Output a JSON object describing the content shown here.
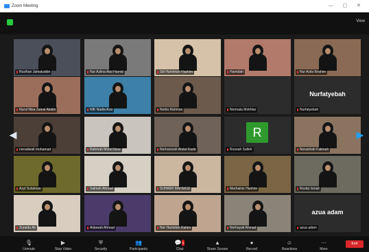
{
  "window": {
    "title": "Zoom Meeting"
  },
  "topbar": {
    "view_label": "View"
  },
  "participants": [
    {
      "name": "Rozihan Jamaluddin",
      "active": true,
      "bg": "#4a4f5a"
    },
    {
      "name": "Nur Azlina Abd Hamid",
      "bg": "#7a7a7a"
    },
    {
      "name": "Siti Hamimah Hashim",
      "bg": "#d6c2a8"
    },
    {
      "name": "Hamidah",
      "bg": "#b27a6a"
    },
    {
      "name": "Nur Azila Ibrahim",
      "bg": "#8a6a54"
    },
    {
      "name": "Nurul Nisa Zainal Abidin",
      "bg": "#9b6e5c"
    },
    {
      "name": "NIK Nadia Aziz",
      "bg": "#3d80a8"
    },
    {
      "name": "Norlia Rahman",
      "bg": "#6c5a4c"
    },
    {
      "name": "Normala Mokhtar",
      "bg": "#2c2c2c",
      "video": false
    },
    {
      "name": "Nurfatyebah",
      "bg": "#2c2c2c",
      "video": false,
      "display": "Nurfatyebah"
    },
    {
      "name": "norsalwati mohamad",
      "bg": "#4b3f38"
    },
    {
      "name": "Rahmah Mohd Noor",
      "bg": "#c9c4bd"
    },
    {
      "name": "Norhanizah Abdul Kadir",
      "bg": "#6f6258"
    },
    {
      "name": "Rosnah Salleh",
      "bg": "#2c2c2c",
      "video": false,
      "avatar": "R"
    },
    {
      "name": "Noraishah Fatimah",
      "bg": "#8a7460"
    },
    {
      "name": "Azyl Sulaiman",
      "bg": "#6e6a2c"
    },
    {
      "name": "Salmah Ahmad",
      "bg": "#d6cfc3"
    },
    {
      "name": "SUHAIRI MAHMOD",
      "bg": "#cbb6a0"
    },
    {
      "name": "Marhainis Hashim",
      "bg": "#7a6544"
    },
    {
      "name": "Rozita Ismail",
      "bg": "#6d6a5f"
    },
    {
      "name": "Zuraida Ali",
      "bg": "#d8cdbf"
    },
    {
      "name": "Aidawati Ahmad",
      "bg": "#4b3b6a"
    },
    {
      "name": "Nor Hamidah Rahim",
      "bg": "#bfa590"
    },
    {
      "name": "Norhayati Ahmad",
      "bg": "#8a8478"
    },
    {
      "name": "azua adam",
      "bg": "#2c2c2c",
      "video": false,
      "display": "azua adam"
    }
  ],
  "toolbar": {
    "items": [
      {
        "label": "Unmute",
        "icon": "microphone-icon",
        "glyph": "🎙"
      },
      {
        "label": "Stop Video",
        "icon": "video-camera-icon",
        "glyph": "▶"
      },
      {
        "label": "Security",
        "icon": "shield-icon",
        "glyph": "⛨"
      },
      {
        "label": "Participants",
        "icon": "participants-icon",
        "glyph": "👥"
      },
      {
        "label": "Chat",
        "icon": "chat-icon",
        "glyph": "💬",
        "badge": "9"
      },
      {
        "label": "Share Screen",
        "icon": "share-screen-icon",
        "glyph": "▲"
      },
      {
        "label": "Record",
        "icon": "record-icon",
        "glyph": "●"
      },
      {
        "label": "Reactions",
        "icon": "reactions-icon",
        "glyph": "☺"
      },
      {
        "label": "More",
        "icon": "more-icon",
        "glyph": "⋯"
      }
    ],
    "end_label": "End"
  }
}
